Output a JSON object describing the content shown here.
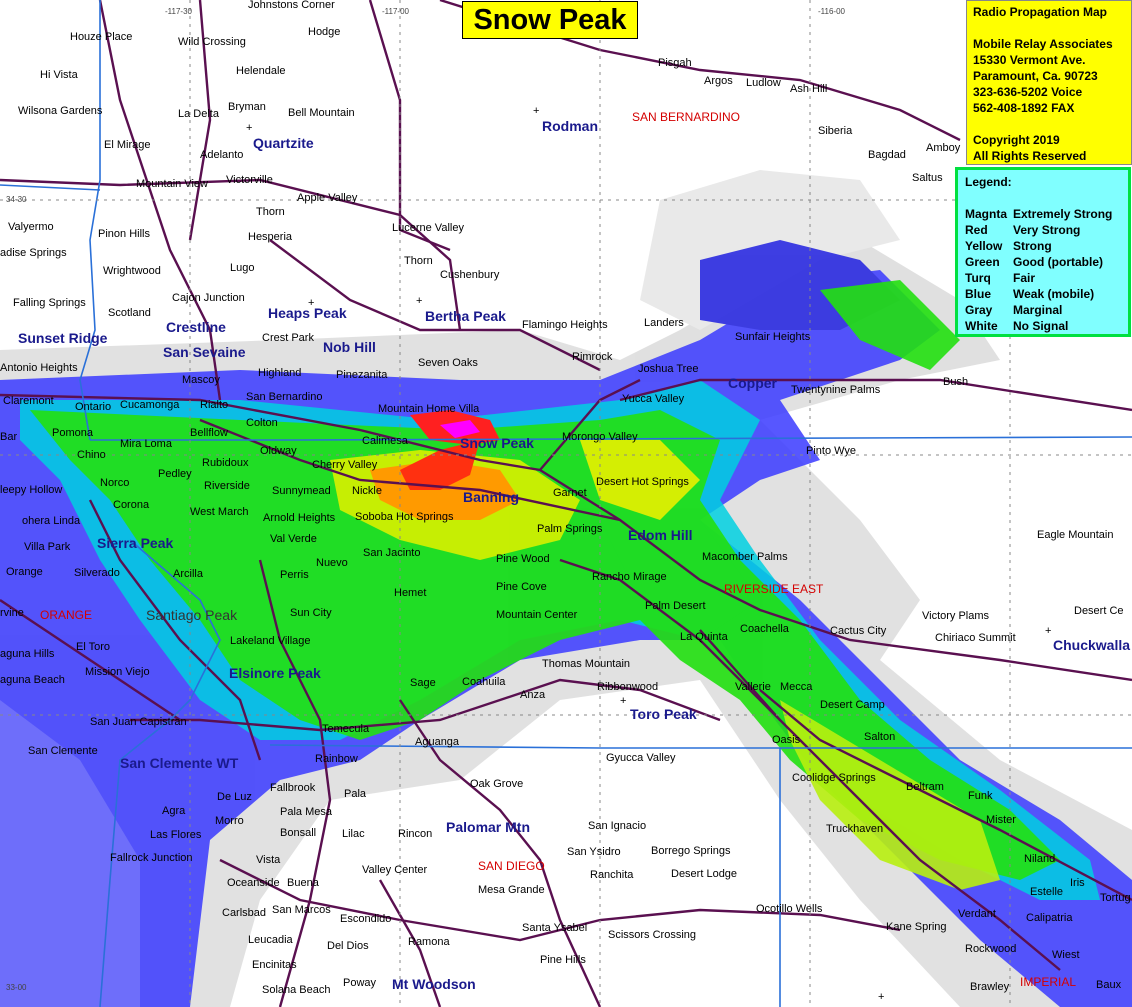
{
  "title": "Snow Peak",
  "info": {
    "lines": [
      "Radio Propagation Map",
      "",
      "Mobile Relay Associates",
      "15330 Vermont Ave.",
      "Paramount, Ca.  90723",
      "323-636-5202 Voice",
      "562-408-1892 FAX",
      "",
      "Copyright 2019",
      "All Rights Reserved"
    ]
  },
  "legend": {
    "title": "Legend:",
    "rows": [
      {
        "color": "Magnta",
        "label": "Extremely Strong"
      },
      {
        "color": "Red",
        "label": "Very Strong"
      },
      {
        "color": "Yellow",
        "label": "Strong"
      },
      {
        "color": "Green",
        "label": "Good (portable)"
      },
      {
        "color": "Turq",
        "label": "Fair"
      },
      {
        "color": "Blue",
        "label": "Weak (mobile)"
      },
      {
        "color": "Gray",
        "label": "Marginal"
      },
      {
        "color": "White",
        "label": "No Signal"
      }
    ]
  },
  "grid_labels": [
    "-117-30",
    "-117-00",
    "-116-00",
    "34-30",
    "33-00"
  ],
  "counties": [
    "SAN BERNARDINO",
    "RIVERSIDE EAST",
    "ORANGE",
    "SAN DIEGO",
    "IMPERIAL"
  ],
  "sites": [
    "Snow Peak",
    "Banning",
    "Rodman",
    "Quartzite",
    "Heaps Peak",
    "Bertha Peak",
    "Crestline",
    "Sunset Ridge",
    "San Sevaine",
    "Nob Hill",
    "Copper",
    "Edom Hill",
    "Sierra Peak",
    "Santiago Peak",
    "Elsinore Peak",
    "Toro Peak",
    "San Clemente WT",
    "Palomar Mtn",
    "Mt Woodson",
    "Chuckwalla"
  ],
  "towns": [
    "Johnstons Corner",
    "Hodge",
    "Houze Place",
    "Wild Crossing",
    "Hi Vista",
    "Helendale",
    "Wilsona Gardens",
    "Bryman",
    "La Delta",
    "Bell Mountain",
    "El Mirage",
    "Adelanto",
    "Mountain View",
    "Victorville",
    "Apple Valley",
    "Valyermo",
    "Thorn",
    "Pinon Hills",
    "Hesperia",
    "Lucerne Valley",
    "adise Springs",
    "Thorn",
    "Wrightwood",
    "Lugo",
    "Cushenbury",
    "Falling Springs",
    "Cajon Junction",
    "Scotland",
    "Crest Park",
    "Flamingo Heights",
    "Landers",
    "Sunfair Heights",
    "Rimrock",
    "Seven Oaks",
    "Antonio Heights",
    "Highland",
    "Pinezanita",
    "Joshua Tree",
    "Twentynine Palms",
    "Bush",
    "Mascoy",
    "Claremont",
    "San Bernardino",
    "Mountain Home Villa",
    "Yucca Valley",
    "Ontario",
    "Cucamonga",
    "Rialto",
    "Colton",
    "Pomona",
    "Bar",
    "Bellflow",
    "Mira Loma",
    "Calimesa",
    "Morongo Valley",
    "Pinto Wye",
    "Chino",
    "Oldway",
    "Cherry Valley",
    "Rubidoux",
    "leepy Hollow",
    "Norco",
    "Pedley",
    "Riverside",
    "Sunnymead",
    "Nickle",
    "Garnet",
    "Desert Hot Springs",
    "Corona",
    "West March",
    "Arnold Heights",
    "Soboba Hot Springs",
    "ohera Linda",
    "Palm Springs",
    "Villa Park",
    "Val Verde",
    "San Jacinto",
    "Pine Wood",
    "Macomber Palms",
    "Eagle Mountain",
    "Orange",
    "Silverado",
    "Arcilla",
    "Perris",
    "Nuevo",
    "Rancho Mirage",
    "Pine Cove",
    "Hemet",
    "Sun City",
    "Palm Desert",
    "Victory Plams",
    "Desert Ce",
    "rvine",
    "Mountain Center",
    "La Quinta",
    "Coachella",
    "Cactus City",
    "Chiriaco Summit",
    "El Toro",
    "aguna Hills",
    "Lakeland Village",
    "Mission Viejo",
    "Thomas Mountain",
    "aguna Beach",
    "Sage",
    "Coahuila",
    "Ribbonwood",
    "Vallerie",
    "Mecca",
    "Anza",
    "Desert Camp",
    "San Juan Capistran",
    "Temecula",
    "Aguanga",
    "Salton",
    "San Clemente",
    "Gyucca Valley",
    "Rainbow",
    "Oasis",
    "Coolidge Springs",
    "Beltram",
    "Fallbrook",
    "Oak Grove",
    "De Luz",
    "Pala",
    "Funk",
    "Agra",
    "Morro",
    "Pala Mesa",
    "Bonsall",
    "Lilac",
    "Las Flores",
    "Rincon",
    "Truckhaven",
    "Mister",
    "San Ignacio",
    "Fallrock Junction",
    "Vista",
    "San Ysidro",
    "Borrego Springs",
    "Niland",
    "Oceanside",
    "Buena",
    "Ranchita",
    "Valley Center",
    "Desert Lodge",
    "Estelle",
    "Iris",
    "Mesa Grande",
    "Tortug",
    "Carlsbad",
    "San Marcos",
    "Escondido",
    "Ocotillo Wells",
    "Verdant",
    "Calipatria",
    "Santa Ysabel",
    "Scissors Crossing",
    "Kane Spring",
    "Encinitas",
    "Del Dios",
    "Ramona",
    "Rockwood",
    "Wiest",
    "Pine Hills",
    "Solana Beach",
    "Poway",
    "Brawley",
    "Pisgah",
    "Argos",
    "Ludlow",
    "Ash Hill",
    "Siberia",
    "Bagdad",
    "Amboy",
    "Saltus",
    "Baux",
    "Leucadia"
  ]
}
